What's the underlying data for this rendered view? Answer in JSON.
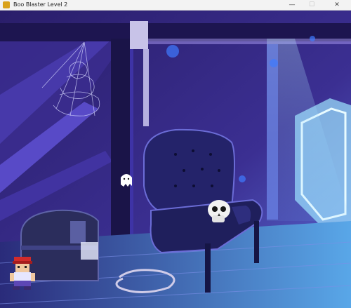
{
  "window": {
    "title": "Boo Blaster Level 2",
    "app_icon": "game-icon",
    "controls": {
      "minimize": "—",
      "maximize": "☐",
      "close": "✕"
    }
  },
  "scene": {
    "setting": "attic",
    "objects": [
      "rafters",
      "cobweb",
      "hanging-rope",
      "armchair",
      "skull",
      "ghost",
      "treasure-chest",
      "coiled-rope",
      "attic-window"
    ],
    "player": "pixel-hero-player"
  },
  "colors": {
    "wall_dark": "#2b1f6e",
    "wall_light": "#5a4fc8",
    "beam": "#1b1446",
    "light_beam": "#8fd0ff",
    "floor": "#3a3a9c",
    "chair": "#24236a",
    "skull": "#f2f2f2"
  }
}
